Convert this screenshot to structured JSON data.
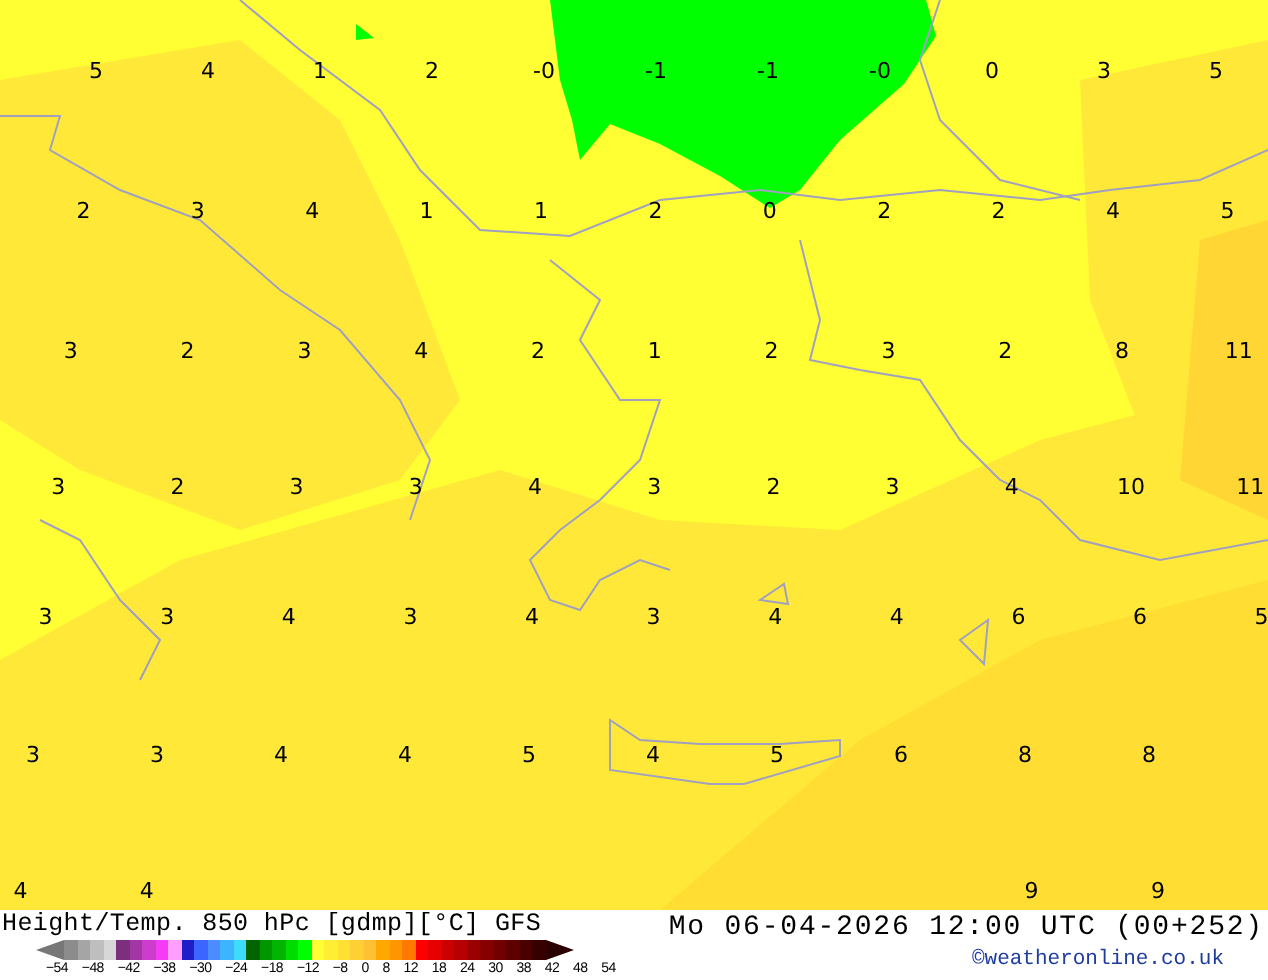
{
  "map": {
    "rows": [
      [
        "5",
        "4",
        "1",
        "2",
        "-0",
        "-1",
        "-1",
        "-0",
        "0",
        "3",
        "5"
      ],
      [
        "2",
        "3",
        "4",
        "1",
        "1",
        "2",
        "0",
        "2",
        "2",
        "4",
        "5"
      ],
      [
        "3",
        "2",
        "3",
        "4",
        "2",
        "1",
        "2",
        "3",
        "2",
        "8",
        "11"
      ],
      [
        "3",
        "2",
        "3",
        "3",
        "4",
        "3",
        "2",
        "3",
        "4",
        "10",
        "11"
      ],
      [
        "3",
        "3",
        "4",
        "3",
        "4",
        "3",
        "4",
        "4",
        "6",
        "6",
        "5"
      ],
      [
        "3",
        "3",
        "4",
        "4",
        "5",
        "4",
        "5",
        "6",
        "8",
        "8",
        null
      ],
      [
        "4",
        "4",
        null,
        null,
        null,
        null,
        null,
        null,
        "9",
        "9",
        null
      ]
    ]
  },
  "footer": {
    "title": "Height/Temp. 850 hPc [gdmp][°C] GFS",
    "datetime": "Mo 06-04-2026 12:00 UTC (00+252)",
    "credit": "©weatheronline.co.uk"
  },
  "legend": {
    "swatches": [
      {
        "color": "#8c8c8c"
      },
      {
        "color": "#a5a5a5"
      },
      {
        "color": "#bebebe"
      },
      {
        "color": "#d7d7d7"
      },
      {
        "color": "#7d2e7d"
      },
      {
        "color": "#a236a5"
      },
      {
        "color": "#cd3dcd"
      },
      {
        "color": "#f53cf5"
      },
      {
        "color": "#ff9eff"
      },
      {
        "color": "#1e1ec8"
      },
      {
        "color": "#3c64ff"
      },
      {
        "color": "#4b8cff"
      },
      {
        "color": "#3cb4ff"
      },
      {
        "color": "#3cdcff"
      },
      {
        "color": "#006400"
      },
      {
        "color": "#009600"
      },
      {
        "color": "#00b400"
      },
      {
        "color": "#00dc00"
      },
      {
        "color": "#00ff00"
      },
      {
        "color": "#ffff33"
      },
      {
        "color": "#ffee33"
      },
      {
        "color": "#ffe033"
      },
      {
        "color": "#ffd033"
      },
      {
        "color": "#ffc033"
      },
      {
        "color": "#ffa800"
      },
      {
        "color": "#ff9600"
      },
      {
        "color": "#ff7800"
      },
      {
        "color": "#ff0000"
      },
      {
        "color": "#e60000"
      },
      {
        "color": "#cc0000"
      },
      {
        "color": "#b40000"
      },
      {
        "color": "#9b0000"
      },
      {
        "color": "#870000"
      },
      {
        "color": "#730000"
      },
      {
        "color": "#5f0000"
      },
      {
        "color": "#4b0000"
      },
      {
        "color": "#370000"
      }
    ],
    "ticks": [
      "−54",
      "−48",
      "−42",
      "−38",
      "−30",
      "−24",
      "−18",
      "−12",
      "−8",
      "0",
      "8",
      "12",
      "18",
      "24",
      "30",
      "38",
      "42",
      "48",
      "54"
    ]
  }
}
